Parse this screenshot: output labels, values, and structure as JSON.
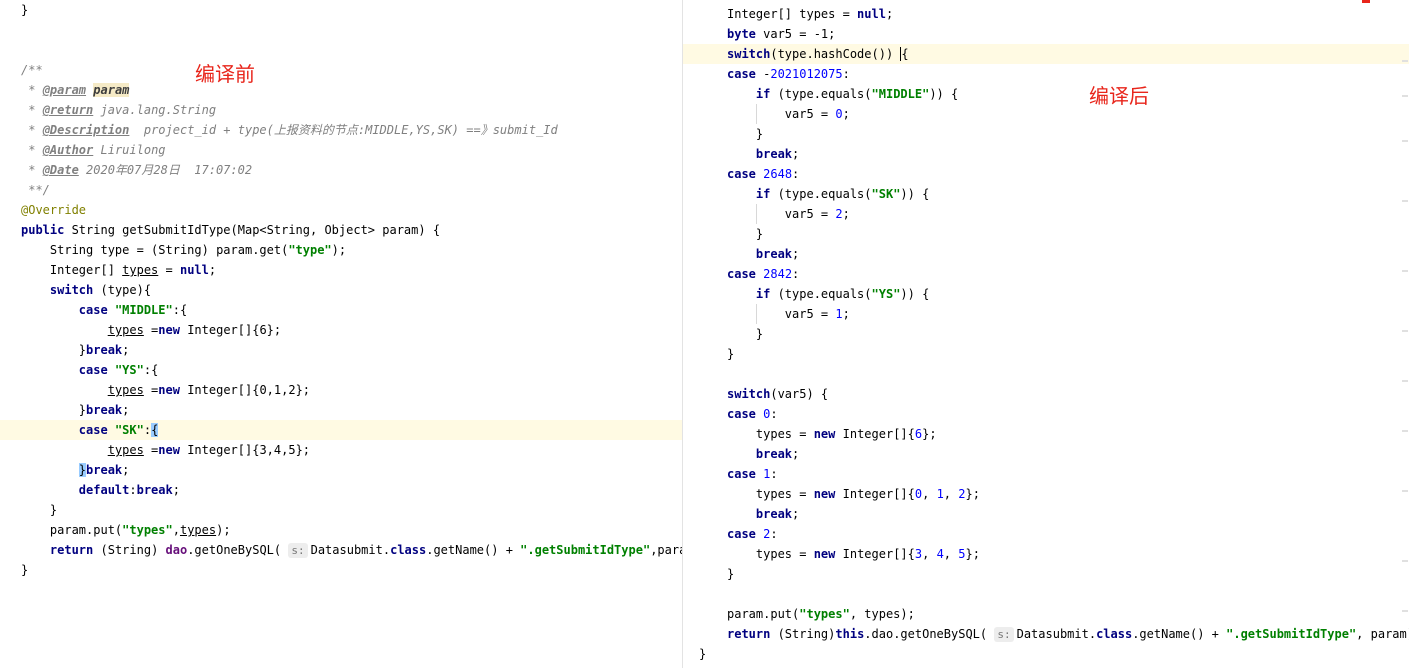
{
  "annotations": {
    "before": "编译前",
    "after": "编译后"
  },
  "left_code": {
    "lines": [
      "}",
      "",
      "",
      "/**",
      " * @param param",
      " * @return java.lang.String",
      " * @Description  project_id + type(上报资料的节点:MIDDLE,YS,SK) ==》submit_Id",
      " * @Author Liruilong",
      " * @Date 2020年07月28日  17:07:02",
      " **/",
      "@Override",
      "public String getSubmitIdType(Map<String, Object> param) {",
      "    String type = (String) param.get(\"type\");",
      "    Integer[] types = null;",
      "    switch (type){",
      "        case \"MIDDLE\":{",
      "            types =new Integer[]{6};",
      "        }break;",
      "        case \"YS\":{",
      "            types =new Integer[]{0,1,2};",
      "        }break;",
      "        case \"SK\":{",
      "            types =new Integer[]{3,4,5};",
      "        }break;",
      "        default:break;",
      "    }",
      "    param.put(\"types\",types);",
      "    return (String) dao.getOneBySQL( s: Datasubmit.class.getName() + \".getSubmitIdType\",param);",
      "}"
    ]
  },
  "right_code": {
    "lines": [
      "        Integer[] types = null;",
      "        byte var5 = -1;",
      "        switch(type.hashCode()) {",
      "        case -2021012075:",
      "            if (type.equals(\"MIDDLE\")) {",
      "                var5 = 0;",
      "            }",
      "            break;",
      "        case 2648:",
      "            if (type.equals(\"SK\")) {",
      "                var5 = 2;",
      "            }",
      "            break;",
      "        case 2842:",
      "            if (type.equals(\"YS\")) {",
      "                var5 = 1;",
      "            }",
      "        }",
      "",
      "        switch(var5) {",
      "        case 0:",
      "            types = new Integer[]{6};",
      "            break;",
      "        case 1:",
      "            types = new Integer[]{0, 1, 2};",
      "            break;",
      "        case 2:",
      "            types = new Integer[]{3, 4, 5};",
      "        }",
      "",
      "        param.put(\"types\", types);",
      "        return (String)this.dao.getOneBySQL( s: Datasubmit.class.getName() + \".getSubmitIdType\", param);",
      "    }"
    ]
  }
}
